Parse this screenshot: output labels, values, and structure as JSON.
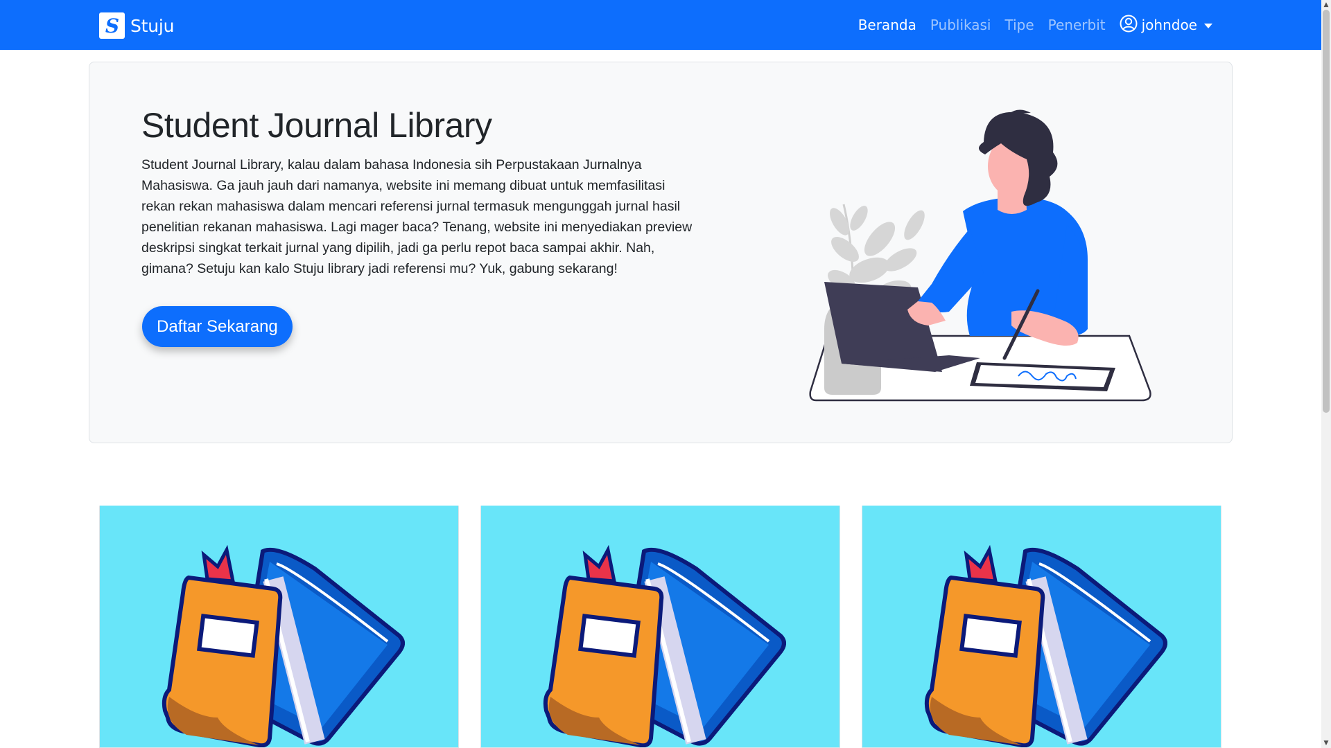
{
  "navbar": {
    "brand_letter": "S",
    "brand_name": "Stuju",
    "links": [
      {
        "label": "Beranda",
        "active": true
      },
      {
        "label": "Publikasi",
        "active": false
      },
      {
        "label": "Tipe",
        "active": false
      },
      {
        "label": "Penerbit",
        "active": false
      }
    ],
    "user": {
      "name": "johndoe"
    },
    "color": "#0d6efd"
  },
  "hero": {
    "title": "Student Journal Library",
    "description": "Student Journal Library, kalau dalam bahasa Indonesia sih Perpustakaan Jurnalnya Mahasiswa. Ga jauh jauh dari namanya, website ini memang dibuat untuk memfasilitasi rekan rekan mahasiswa dalam mencari referensi jurnal termasuk mengunggah jurnal hasil penelitian rekanan mahasiswa. Lagi mager baca? Tenang, website ini menyediakan preview deskripsi singkat terkait jurnal yang dipilih, jadi ga perlu repot baca sampai akhir. Nah, gimana? Setuju kan kalo Stuju library jadi referensi mu? Yuk, gabung sekarang!",
    "cta_label": "Daftar Sekarang",
    "illustration": "woman-writing-on-tablet-illustration"
  },
  "cards": [
    {
      "image": "books-illustration",
      "background": "#68e5f9"
    },
    {
      "image": "books-illustration",
      "background": "#68e5f9"
    },
    {
      "image": "books-illustration",
      "background": "#68e5f9"
    }
  ]
}
